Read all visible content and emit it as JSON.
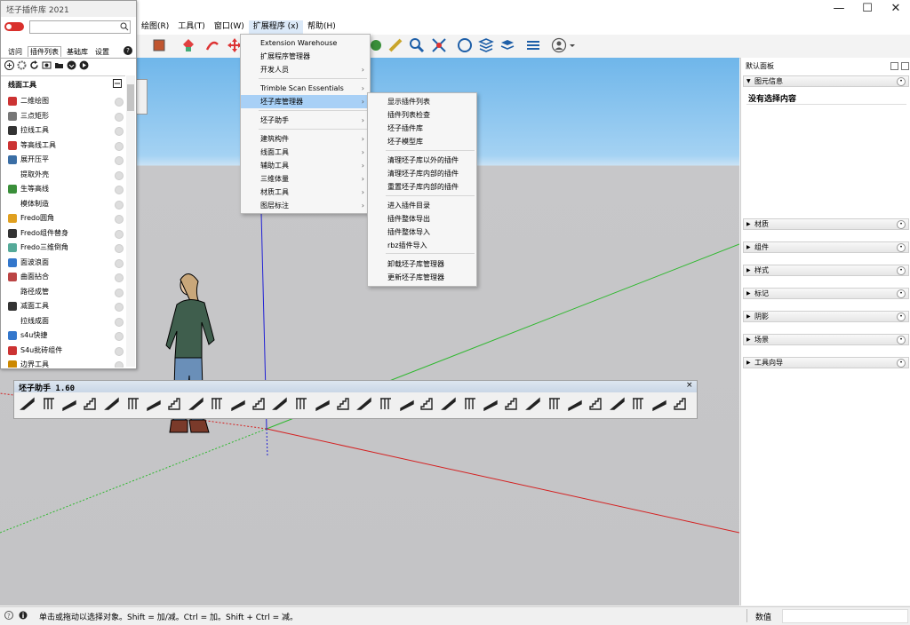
{
  "window": {
    "controls": [
      "—",
      "☐",
      "✕"
    ]
  },
  "menubar": [
    "绘图(R)",
    "工具(T)",
    "窗口(W)",
    "扩展程序 (x)",
    "帮助(H)"
  ],
  "left_panel": {
    "title": "坯子插件库 2021",
    "tabs": [
      "访问",
      "插件列表",
      "基础库",
      "设置"
    ],
    "help": "?",
    "section": "线面工具",
    "items": [
      "二维绘图",
      "三点矩形",
      "拉线工具",
      "等高线工具",
      "展开压平",
      "提取外壳",
      "生等高线",
      "模体制造",
      "Fredo圆角",
      "Fredo组件替身",
      "Fredo三维倒角",
      "面波浪面",
      "曲面拈合",
      "路径成管",
      "减面工具",
      "拉线成面",
      "s4u快捷",
      "S4u批砖组件",
      "边界工具"
    ]
  },
  "ext_menu": {
    "items": [
      "Extension Warehouse",
      "扩展程序管理器",
      "开发人员",
      "Trimble Scan Essentials",
      "坯子库管理器",
      "坯子助手",
      "建筑构件",
      "线面工具",
      "辅助工具",
      "三维体量",
      "材质工具",
      "图层标注"
    ],
    "submenu_flags": [
      false,
      false,
      true,
      true,
      true,
      true,
      true,
      true,
      true,
      true,
      true,
      true
    ],
    "highlighted": "坯子库管理器"
  },
  "sub_menu": {
    "items": [
      "显示插件列表",
      "插件列表检查",
      "坯子插件库",
      "坯子模型库",
      "清理坯子库以外的插件",
      "清理坯子库内部的插件",
      "重置坯子库内部的插件",
      "进入插件目录",
      "插件整体导出",
      "插件整体导入",
      "rbz插件导入",
      "卸载坯子库管理器",
      "更新坯子库管理器"
    ]
  },
  "tray": {
    "title": "默认面板",
    "entity_info": "图元信息",
    "no_selection": "没有选择内容",
    "panels": [
      "材质",
      "组件",
      "样式",
      "标记",
      "阴影",
      "场景",
      "工具向导"
    ]
  },
  "ztoolbar": {
    "title": "坯子助手 1.60",
    "close": "×"
  },
  "status": {
    "message": "单击或拖动以选择对象。Shift = 加/减。Ctrl = 加。Shift + Ctrl = 减。",
    "measure_label": "数值"
  },
  "colors": {
    "accent": "#0078d7",
    "highlight": "#a8d0f6",
    "sky": "#8ec6ef",
    "ground": "#c4c4c6"
  }
}
